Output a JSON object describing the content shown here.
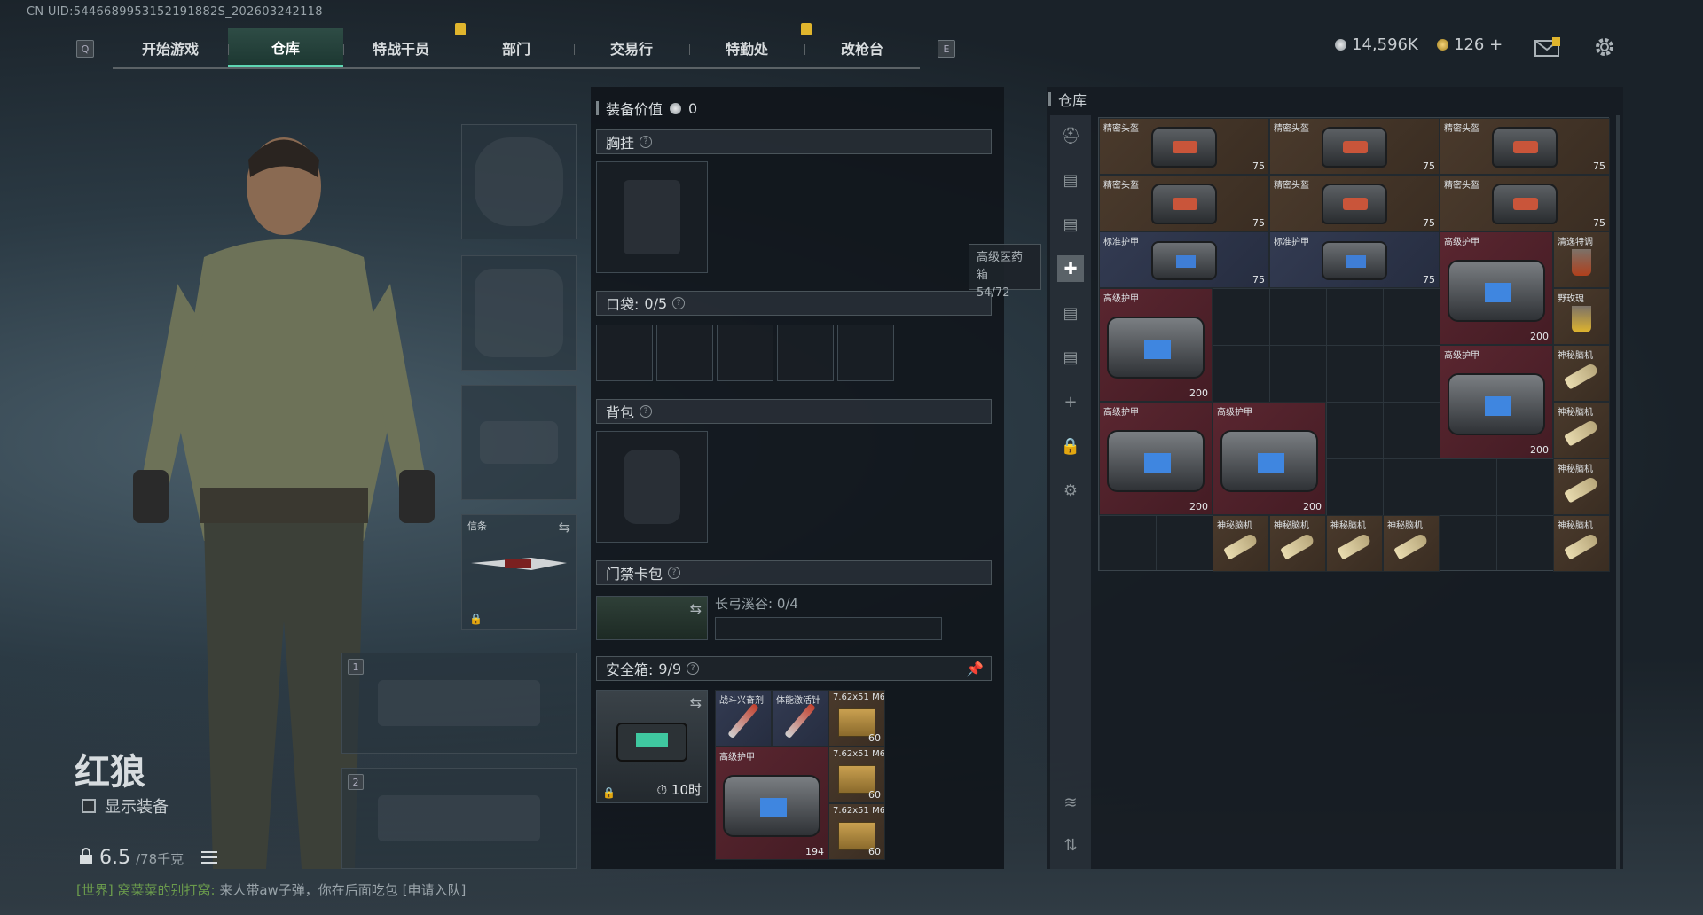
{
  "uid": "CN UID:5446689953152191882S_202603242118",
  "nav": {
    "left_key": "Q",
    "right_key": "E",
    "tabs": [
      "开始游戏",
      "仓库",
      "特战干员",
      "部门",
      "交易行",
      "特勤处",
      "改枪台"
    ],
    "active_tab": "仓库",
    "tabs_with_alert": [
      "特战干员",
      "特勤处"
    ]
  },
  "currency": {
    "coins": "14,596K",
    "premium": "126 +"
  },
  "agent": {
    "name": "红狼",
    "show_equipment_label": "显示装备",
    "weight": "6.5",
    "weight_max": "/78千克"
  },
  "loadout": {
    "melee_label": "信条",
    "weapon_slot_1": "1",
    "weapon_slot_2": "2"
  },
  "equipment": {
    "value_label": "装备价值",
    "value": "0",
    "chest_rig": "胸挂",
    "pockets_label": "口袋:",
    "pockets_count": "0/5",
    "backpack": "背包",
    "keycard_case": "门禁卡包",
    "keycard_map": "长弓溪谷: 0/4",
    "secure_case_label": "安全箱:",
    "secure_case_count": "9/9",
    "secure_case_timer": "10时",
    "secure_items": [
      {
        "name": "战斗兴奋剂",
        "count": ""
      },
      {
        "name": "体能激活针",
        "count": ""
      },
      {
        "name": "7.62x51 M61",
        "count": "60"
      },
      {
        "name": "高级护甲",
        "count": "194"
      },
      {
        "name": "7.62x51 M61",
        "count": "60"
      },
      {
        "name": "7.62x51 M61",
        "count": "60"
      }
    ]
  },
  "tooltip": {
    "name": "高级医药箱",
    "count": "54/72"
  },
  "warehouse": {
    "title": "仓库",
    "items": [
      {
        "name": "精密头盔",
        "count": "75"
      },
      {
        "name": "精密头盔",
        "count": "75"
      },
      {
        "name": "精密头盔",
        "count": "75"
      },
      {
        "name": "精密头盔",
        "count": "75"
      },
      {
        "name": "精密头盔",
        "count": "75"
      },
      {
        "name": "精密头盔",
        "count": "75"
      },
      {
        "name": "标准护甲",
        "count": "75"
      },
      {
        "name": "标准护甲",
        "count": "75"
      },
      {
        "name": "高级护甲",
        "count": "200"
      },
      {
        "name": "清逸特调",
        "count": ""
      },
      {
        "name": "野玫瑰",
        "count": ""
      },
      {
        "name": "高级护甲",
        "count": "200"
      },
      {
        "name": "高级护甲",
        "count": "200"
      },
      {
        "name": "神秘脑机",
        "count": ""
      },
      {
        "name": "神秘脑机",
        "count": ""
      },
      {
        "name": "高级护甲",
        "count": "200"
      },
      {
        "name": "高级护甲",
        "count": "200"
      },
      {
        "name": "神秘脑机",
        "count": ""
      },
      {
        "name": "神秘脑机",
        "count": ""
      },
      {
        "name": "神秘脑机",
        "count": ""
      },
      {
        "name": "神秘脑机",
        "count": ""
      },
      {
        "name": "神秘脑机",
        "count": ""
      },
      {
        "name": "神秘脑机",
        "count": ""
      }
    ]
  },
  "chat": {
    "channel": "[世界]",
    "user": "窝菜菜的别打窝:",
    "message": "来人带aw子弹，你在后面吃包",
    "action": "[申请入队]"
  },
  "colors": {
    "accent": "#5ed6b3",
    "alert": "#e0b52d",
    "rare_red": "#5a2630",
    "rare_brown": "#4a3a2c",
    "rare_blue": "#333b52"
  }
}
